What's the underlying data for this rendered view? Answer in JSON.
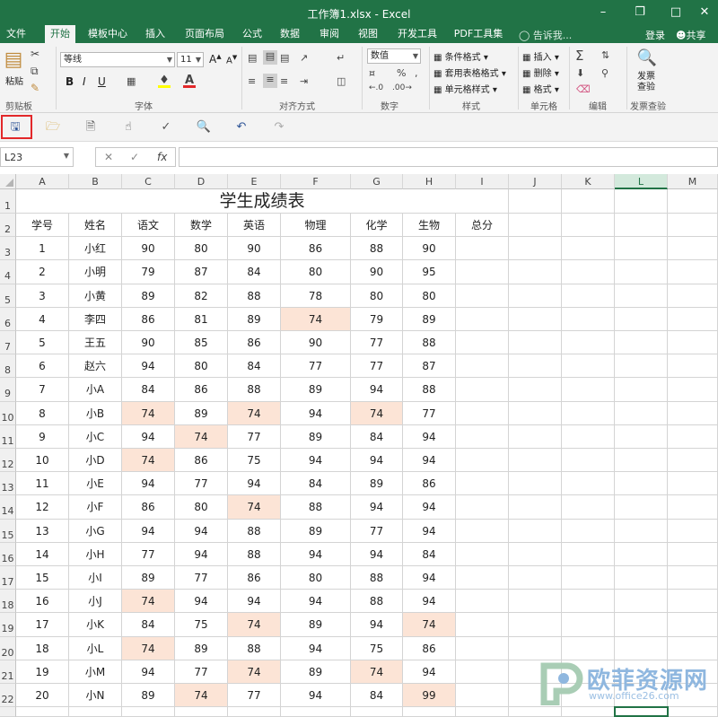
{
  "window": {
    "title": "工作簿1.xlsx - Excel",
    "minimize_icon": "minimize-icon",
    "maximize_icon": "restore-icon",
    "close_icon": "close-icon"
  },
  "tabs": [
    "文件",
    "开始",
    "模板中心",
    "插入",
    "页面布局",
    "公式",
    "数据",
    "审阅",
    "视图",
    "开发工具",
    "PDF工具集"
  ],
  "active_tab": "开始",
  "tell_me": "告诉我...",
  "login": "登录",
  "share": "共享",
  "ribbon": {
    "font_name": "等线",
    "font_size": "11",
    "number_format": "数值",
    "bold": "B",
    "italic": "I",
    "underline": "U",
    "font_grow": "A",
    "font_shrink": "A",
    "paste": "粘贴",
    "cond_format": "条件格式",
    "table_format": "套用表格格式",
    "cell_style": "单元格样式",
    "insert": "插入",
    "delete": "删除",
    "format": "格式",
    "invoice_check": "发票查验",
    "groups": [
      "剪贴板",
      "字体",
      "对齐方式",
      "数字",
      "样式",
      "单元格",
      "编辑",
      "发票查验"
    ]
  },
  "qat": {
    "save_icon": "save-icon",
    "open_icon": "open-folder-icon",
    "new_icon": "new-file-icon",
    "touch_icon": "touch-mode-icon",
    "spell_icon": "spell-check-icon",
    "preview_icon": "print-preview-icon",
    "undo_icon": "undo-icon",
    "redo_icon": "redo-icon"
  },
  "name_box": "L23",
  "fx_label": "fx",
  "formula_value": "",
  "columns": [
    "A",
    "B",
    "C",
    "D",
    "E",
    "F",
    "G",
    "H",
    "I",
    "J",
    "K",
    "L",
    "M"
  ],
  "selected_column": "L",
  "sheet": {
    "title": "学生成绩表",
    "headers": [
      "学号",
      "姓名",
      "语文",
      "数学",
      "英语",
      "物理",
      "化学",
      "生物",
      "总分"
    ],
    "rows": [
      [
        "1",
        "小红",
        "90",
        "80",
        "90",
        "86",
        "88",
        "90"
      ],
      [
        "2",
        "小明",
        "79",
        "87",
        "84",
        "80",
        "90",
        "95"
      ],
      [
        "3",
        "小黄",
        "89",
        "82",
        "88",
        "78",
        "80",
        "80"
      ],
      [
        "4",
        "李四",
        "86",
        "81",
        "89",
        "74",
        "79",
        "89"
      ],
      [
        "5",
        "王五",
        "90",
        "85",
        "86",
        "90",
        "77",
        "88"
      ],
      [
        "6",
        "赵六",
        "94",
        "80",
        "84",
        "77",
        "77",
        "87"
      ],
      [
        "7",
        "小A",
        "84",
        "86",
        "88",
        "89",
        "94",
        "88"
      ],
      [
        "8",
        "小B",
        "74",
        "89",
        "74",
        "94",
        "74",
        "77"
      ],
      [
        "9",
        "小C",
        "94",
        "74",
        "77",
        "89",
        "84",
        "94"
      ],
      [
        "10",
        "小D",
        "74",
        "86",
        "75",
        "94",
        "94",
        "94"
      ],
      [
        "11",
        "小E",
        "94",
        "77",
        "94",
        "84",
        "89",
        "86"
      ],
      [
        "12",
        "小F",
        "86",
        "80",
        "74",
        "88",
        "94",
        "94"
      ],
      [
        "13",
        "小G",
        "94",
        "94",
        "88",
        "89",
        "77",
        "94"
      ],
      [
        "14",
        "小H",
        "77",
        "94",
        "88",
        "94",
        "94",
        "84"
      ],
      [
        "15",
        "小I",
        "89",
        "77",
        "86",
        "80",
        "88",
        "94"
      ],
      [
        "16",
        "小J",
        "74",
        "94",
        "94",
        "94",
        "88",
        "94"
      ],
      [
        "17",
        "小K",
        "84",
        "75",
        "74",
        "89",
        "94",
        "74"
      ],
      [
        "18",
        "小L",
        "74",
        "89",
        "88",
        "94",
        "75",
        "86"
      ],
      [
        "19",
        "小M",
        "94",
        "77",
        "74",
        "89",
        "74",
        "94"
      ],
      [
        "20",
        "小N",
        "89",
        "74",
        "77",
        "94",
        "84",
        "99"
      ]
    ],
    "highlight_color": "#fce4d6"
  },
  "colors": {
    "brand": "#217346",
    "save_highlight": "#e2282a"
  },
  "watermark": {
    "text": "欧菲资源网",
    "url": "www.office26.com"
  }
}
